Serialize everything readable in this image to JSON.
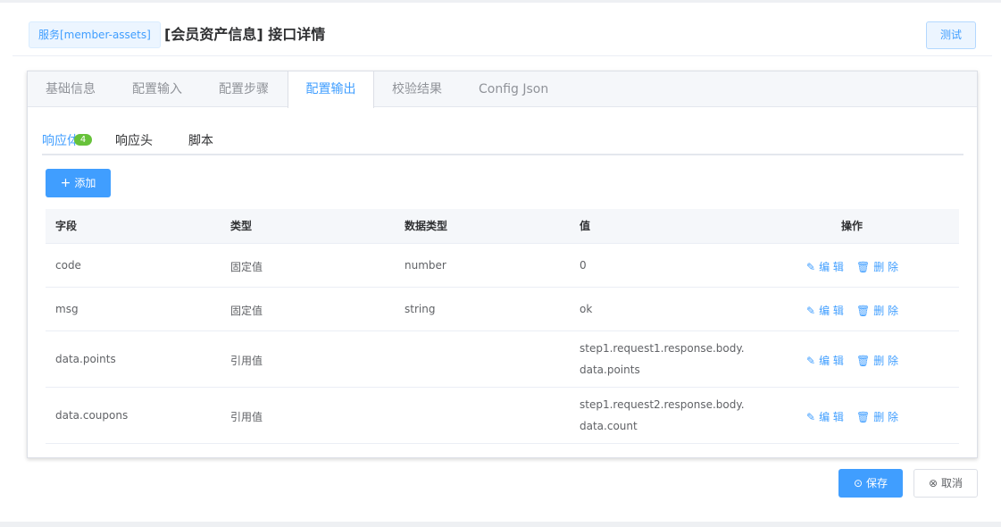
{
  "header": {
    "service_tag": "服务[member-assets]",
    "title": "[会员资产信息] 接口详情",
    "test_label": "测试"
  },
  "tabs": [
    {
      "label": "基础信息",
      "active": false
    },
    {
      "label": "配置输入",
      "active": false
    },
    {
      "label": "配置步骤",
      "active": false
    },
    {
      "label": "配置输出",
      "active": true
    },
    {
      "label": "校验结果",
      "active": false
    },
    {
      "label": "Config Json",
      "active": false
    }
  ],
  "subtabs": [
    {
      "label": "响应体",
      "active": true,
      "badge": "4"
    },
    {
      "label": "响应头",
      "active": false
    },
    {
      "label": "脚本",
      "active": false
    }
  ],
  "add_button": {
    "icon": "plus-icon",
    "label": "添加"
  },
  "table": {
    "columns": [
      "字段",
      "类型",
      "数据类型",
      "值",
      "操作"
    ],
    "rows": [
      {
        "field": "code",
        "type": "固定值",
        "data_type": "number",
        "value_line1": "0",
        "value_line2": ""
      },
      {
        "field": "msg",
        "type": "固定值",
        "data_type": "string",
        "value_line1": "ok",
        "value_line2": ""
      },
      {
        "field": "data.points",
        "type": "引用值",
        "data_type": "",
        "value_line1": "step1.request1.response.body.",
        "value_line2": "data.points"
      },
      {
        "field": "data.coupons",
        "type": "引用值",
        "data_type": "",
        "value_line1": "step1.request2.response.body.",
        "value_line2": "data.count"
      }
    ],
    "actions": {
      "edit": "编 辑",
      "delete": "删 除",
      "edit_icon": "edit-icon",
      "delete_icon": "trash-icon"
    }
  },
  "footer": {
    "save_label": "保存",
    "save_icon": "check-circle-icon",
    "cancel_label": "取消",
    "cancel_icon": "close-circle-icon"
  },
  "colors": {
    "primary": "#409eff",
    "badge": "#67c23a",
    "tab_bg": "#f5f7fa"
  }
}
